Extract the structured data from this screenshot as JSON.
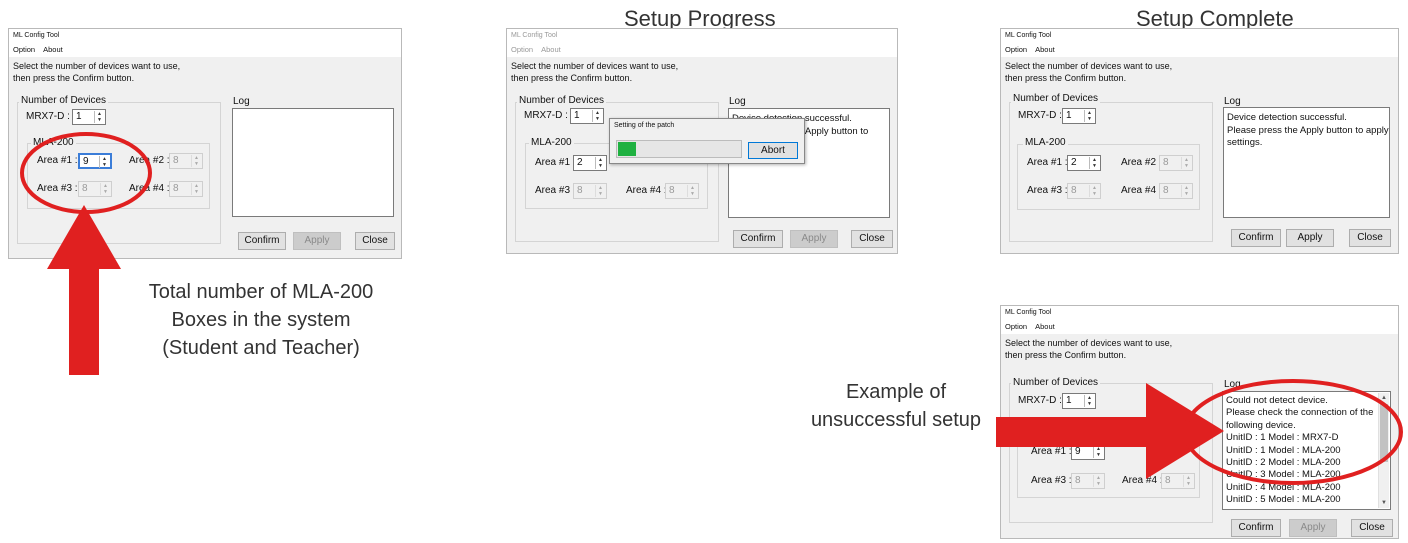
{
  "headings": {
    "progress": "Setup Progress",
    "complete": "Setup Complete"
  },
  "app": {
    "title": "ML Config Tool",
    "menu": [
      "Option",
      "About"
    ],
    "instruction_line1": "Select the number of devices want to use,",
    "instruction_line2": "then press the Confirm button.",
    "number_of_devices_label": "Number of Devices",
    "mrx_label": "MRX7-D :",
    "mla_label": "MLA-200",
    "area1_label": "Area #1 :",
    "area2_label": "Area #2 :",
    "area3_label": "Area #3 :",
    "area4_label": "Area #4 :",
    "log_label": "Log",
    "confirm_label": "Confirm",
    "apply_label": "Apply",
    "close_label": "Close"
  },
  "screens": {
    "initial": {
      "mrx": "1",
      "area1": "9",
      "area2": "8",
      "area3": "8",
      "area4": "8",
      "log": []
    },
    "progress": {
      "mrx": "1",
      "area1": "2",
      "area3": "8",
      "area4": "8",
      "log": [
        "Device detection successful.",
        "Please press the Apply button to apply settings."
      ],
      "popup_title": "Setting of the patch",
      "popup_abort": "Abort",
      "progress_fraction": 0.15
    },
    "complete": {
      "mrx": "1",
      "area1": "2",
      "area2": "8",
      "area3": "8",
      "area4": "8",
      "log": [
        "Device detection successful.",
        "Please press the Apply button to apply",
        "settings."
      ]
    },
    "failed": {
      "mrx": "1",
      "area1": "9",
      "area3": "8",
      "area4": "8",
      "log": [
        "Could not detect device.",
        "Please check the connection of the",
        "following device.",
        "UnitID : 1 Model : MRX7-D",
        "UnitID : 1 Model : MLA-200",
        "UnitID : 2 Model : MLA-200",
        "UnitID : 3 Model : MLA-200",
        "UnitID : 4 Model : MLA-200",
        "UnitID : 5 Model : MLA-200"
      ]
    }
  },
  "annotations": {
    "total_line1": "Total number of MLA-200",
    "total_line2": "Boxes in the system",
    "total_line3": "(Student and Teacher)",
    "fail_line1": "Example of",
    "fail_line2": "unsuccessful setup"
  },
  "colors": {
    "highlight_red": "#e02020",
    "progress_green": "#1fb141"
  }
}
